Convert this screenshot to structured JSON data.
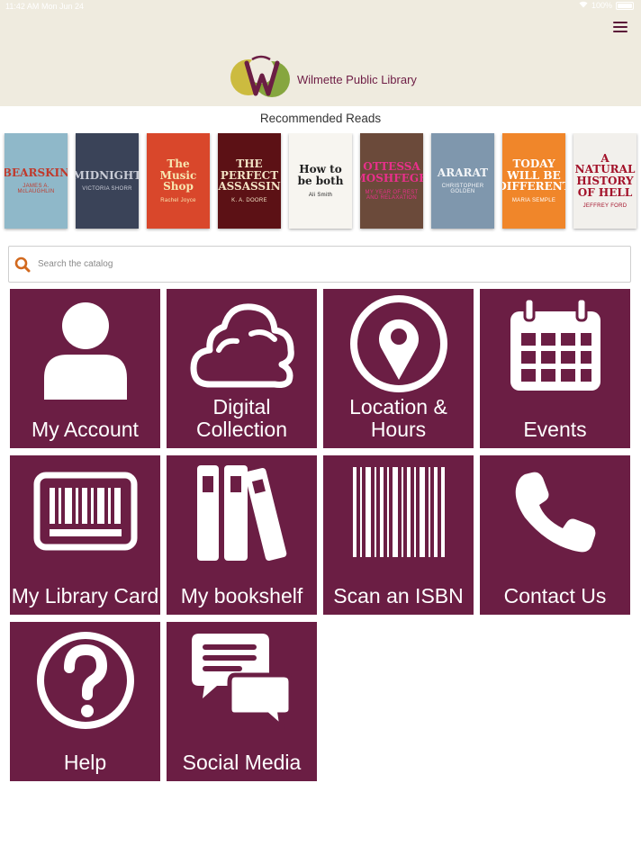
{
  "status_bar": {
    "time": "11:42 AM",
    "date": "Mon Jun 24",
    "battery": "100%"
  },
  "header": {
    "logo_text": "Wilmette Public Library",
    "menu_icon": "hamburger-menu-icon"
  },
  "recommended": {
    "title": "Recommended Reads",
    "books": [
      {
        "title": "BEARSKIN",
        "author": "JAMES A. McLAUGHLIN",
        "bg": "#8fb8c9",
        "fg": "#c0392b"
      },
      {
        "title": "MIDNIGHT",
        "author": "VICTORIA SHORR",
        "bg": "#3a4358",
        "fg": "#c9ccd6"
      },
      {
        "title": "The Music Shop",
        "author": "Rachel Joyce",
        "bg": "#d9472b",
        "fg": "#f7e6b0"
      },
      {
        "title": "THE PERFECT ASSASSIN",
        "author": "K. A. DOORE",
        "bg": "#5c1115",
        "fg": "#f2e2c4"
      },
      {
        "title": "How to be both",
        "author": "Ali Smith",
        "bg": "#f7f5f0",
        "fg": "#222222"
      },
      {
        "title": "OTTESSA MOSHFEGH",
        "author": "MY YEAR OF REST AND RELAXATION",
        "bg": "#6b4a3a",
        "fg": "#e8308b"
      },
      {
        "title": "ARARAT",
        "author": "CHRISTOPHER GOLDEN",
        "bg": "#7f97ad",
        "fg": "#f4f6f8"
      },
      {
        "title": "TODAY WILL BE DIFFERENT",
        "author": "MARIA SEMPLE",
        "bg": "#f0862a",
        "fg": "#ffffff"
      },
      {
        "title": "A NATURAL HISTORY OF HELL",
        "author": "JEFFREY FORD",
        "bg": "#f2f0ec",
        "fg": "#a3122a"
      }
    ]
  },
  "search": {
    "placeholder": "Search the catalog"
  },
  "tiles": [
    {
      "label": "My Account",
      "icon": "person-icon"
    },
    {
      "label": "Digital Collection",
      "icon": "cloud-icon"
    },
    {
      "label": "Location & Hours",
      "icon": "map-pin-icon"
    },
    {
      "label": "Events",
      "icon": "calendar-icon"
    },
    {
      "label": "My Library Card",
      "icon": "library-card-icon"
    },
    {
      "label": "My bookshelf",
      "icon": "books-icon"
    },
    {
      "label": "Scan an ISBN",
      "icon": "barcode-icon"
    },
    {
      "label": "Contact Us",
      "icon": "phone-icon"
    },
    {
      "label": "Help",
      "icon": "help-icon"
    },
    {
      "label": "Social Media",
      "icon": "chat-bubbles-icon"
    }
  ],
  "colors": {
    "tile_bg": "#6b1e44",
    "header_bg": "#efebdf",
    "search_icon": "#d2691e"
  }
}
